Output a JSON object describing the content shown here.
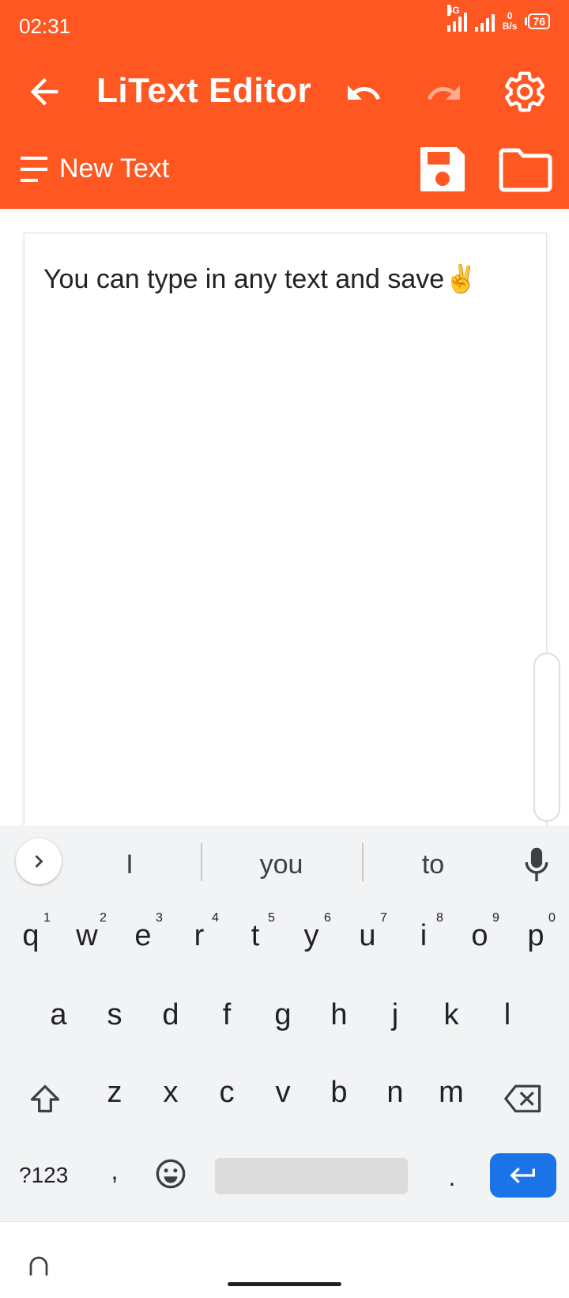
{
  "status": {
    "time": "02:31",
    "network": "4G",
    "speed_value": "0",
    "speed_unit": "B/s",
    "battery": "76"
  },
  "app": {
    "title": "LiText Editor",
    "document_name": "New Text"
  },
  "editor": {
    "text": "You can type in any text and save✌️"
  },
  "suggestions": [
    "I",
    "you",
    "to"
  ],
  "keyboard": {
    "row1": [
      "q",
      "w",
      "e",
      "r",
      "t",
      "y",
      "u",
      "i",
      "o",
      "p"
    ],
    "row1_hints": [
      "1",
      "2",
      "3",
      "4",
      "5",
      "6",
      "7",
      "8",
      "9",
      "0"
    ],
    "row2": [
      "a",
      "s",
      "d",
      "f",
      "g",
      "h",
      "j",
      "k",
      "l"
    ],
    "row3": [
      "z",
      "x",
      "c",
      "v",
      "b",
      "n",
      "m"
    ],
    "symbols_label": "?123",
    "comma": ",",
    "period": "."
  },
  "colors": {
    "brand": "#ff5722",
    "keyboard_bg": "#f1f3f4",
    "enter_key": "#1a73e8"
  },
  "icons": [
    "back-arrow-icon",
    "undo-icon",
    "redo-icon",
    "gear-icon",
    "menu-icon",
    "save-icon",
    "folder-icon",
    "chevron-right-icon",
    "mic-icon",
    "shift-icon",
    "backspace-icon",
    "emoji-icon",
    "enter-icon"
  ]
}
